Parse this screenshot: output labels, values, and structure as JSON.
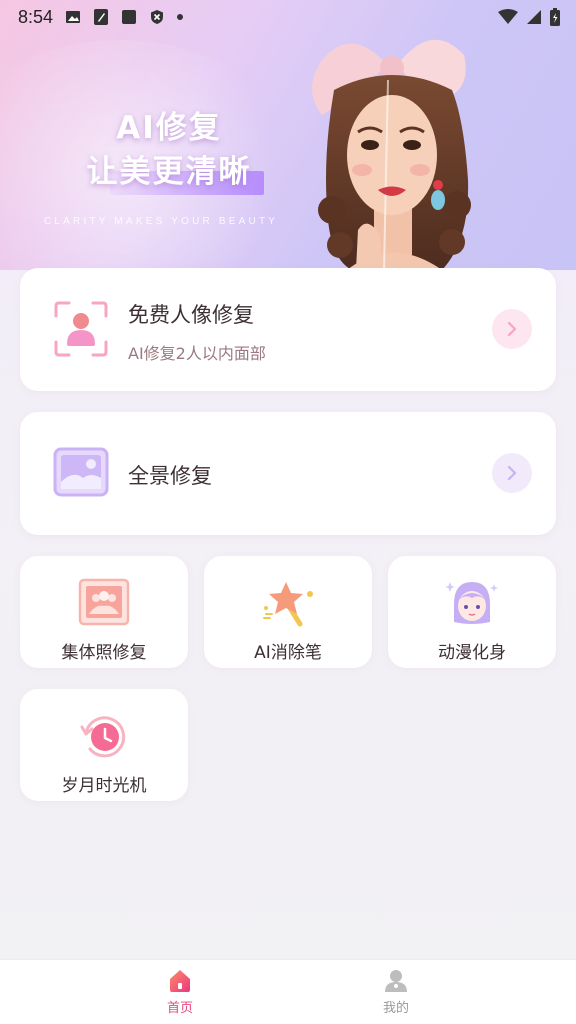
{
  "status_bar": {
    "time": "8:54",
    "icons": [
      "image-icon",
      "edit-icon",
      "square-icon",
      "shield-icon",
      "dot-icon",
      "wifi-icon",
      "signal-icon",
      "battery-icon"
    ]
  },
  "banner": {
    "title_line1": "AI修复",
    "title_line2": "让美更清晰",
    "subtitle": "CLARITY MAKES  YOUR BEAUTY"
  },
  "cards": {
    "portrait": {
      "title": "免费人像修复",
      "subtitle": "AI修复2人以内面部",
      "icon": "portrait-scan-icon"
    },
    "panorama": {
      "title": "全景修复",
      "icon": "landscape-photo-icon"
    }
  },
  "tools": [
    {
      "label": "集体照修复",
      "icon": "group-photo-icon"
    },
    {
      "label": "AI消除笔",
      "icon": "magic-wand-icon"
    },
    {
      "label": "动漫化身",
      "icon": "anime-avatar-icon"
    },
    {
      "label": "岁月时光机",
      "icon": "time-machine-icon"
    }
  ],
  "nav": {
    "home_label": "首页",
    "mine_label": "我的"
  },
  "colors": {
    "accent_pink": "#e8487e",
    "accent_purple": "#a98cf0"
  }
}
